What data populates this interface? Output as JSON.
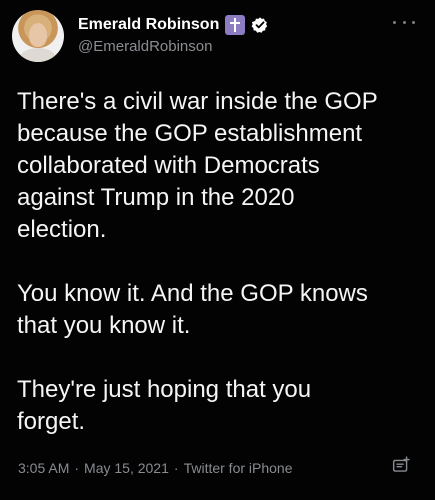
{
  "tweet": {
    "author": {
      "display_name": "Emerald Robinson",
      "handle": "@EmeraldRobinson",
      "avatar_icon": "profile-photo-avatar",
      "badges": [
        "cross-badge",
        "verified-badge"
      ]
    },
    "text": "There's a civil war inside the GOP\nbecause the GOP establishment\ncollaborated with Democrats\nagainst Trump in the 2020\nelection.\n\nYou know it. And the GOP knows\nthat you know it.\n\nThey're just hoping that you\nforget.",
    "time": "3:05 AM",
    "date": "May 15, 2021",
    "source": "Twitter for iPhone",
    "separator": "·",
    "colors": {
      "background": "#030303",
      "primary_text": "#f5f5f5",
      "secondary_text": "#888b90",
      "cross_badge": "#8e7cc3",
      "verified_badge": "#ffffff"
    },
    "icons": {
      "more": "more-options-icon",
      "reply_type": "reply-icon"
    }
  }
}
